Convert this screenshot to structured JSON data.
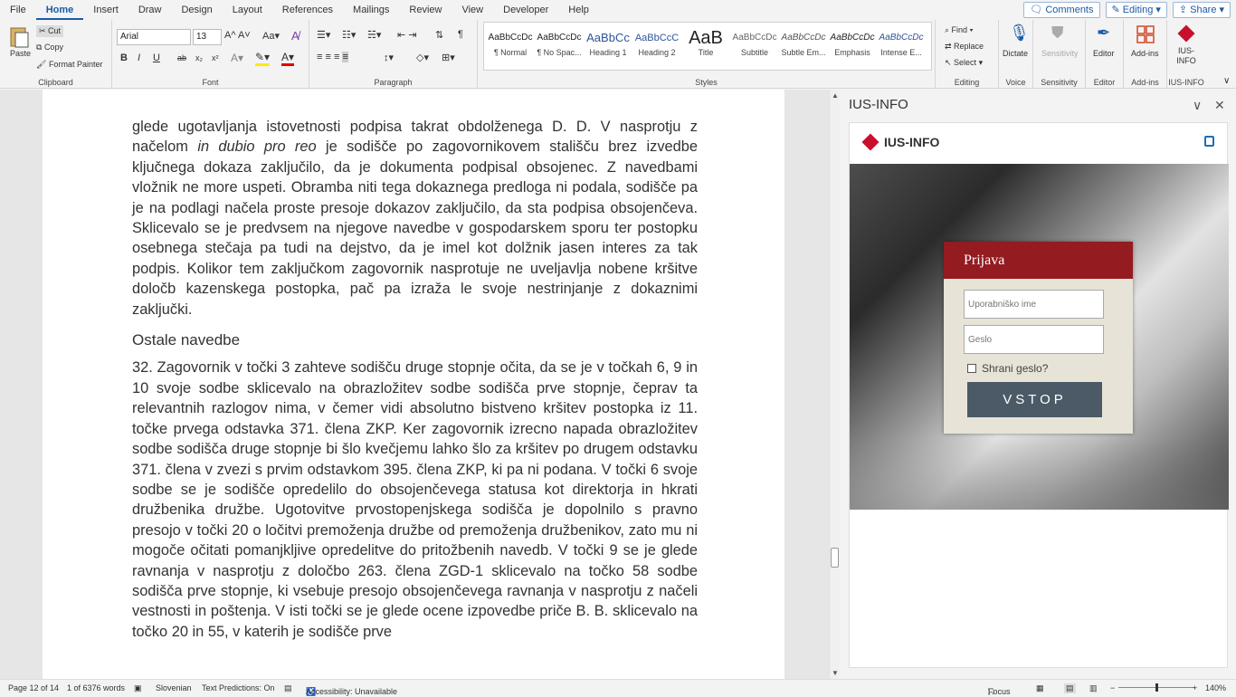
{
  "menu": {
    "tabs": [
      "File",
      "Home",
      "Insert",
      "Draw",
      "Design",
      "Layout",
      "References",
      "Mailings",
      "Review",
      "View",
      "Developer",
      "Help"
    ],
    "active": "Home",
    "comments": "Comments",
    "editing": "Editing",
    "share": "Share"
  },
  "ribbon": {
    "clipboard": {
      "paste": "Paste",
      "cut": "Cut",
      "copy": "Copy",
      "format_painter": "Format Painter",
      "label": "Clipboard"
    },
    "font": {
      "name": "Arial",
      "size": "13",
      "label": "Font",
      "bold": "B",
      "italic": "I",
      "underline": "U",
      "strike": "ab",
      "sub": "x₂",
      "sup": "x²"
    },
    "paragraph": {
      "label": "Paragraph"
    },
    "styles": {
      "label": "Styles",
      "items": [
        {
          "sample": "AaBbCcDc",
          "name": "¶ Normal"
        },
        {
          "sample": "AaBbCcDc",
          "name": "¶ No Spac..."
        },
        {
          "sample": "AaBbCc",
          "name": "Heading 1"
        },
        {
          "sample": "AaBbCcC",
          "name": "Heading 2"
        },
        {
          "sample": "AaB",
          "name": "Title"
        },
        {
          "sample": "AaBbCcDc",
          "name": "Subtitle"
        },
        {
          "sample": "AaBbCcDc",
          "name": "Subtle Em..."
        },
        {
          "sample": "AaBbCcDc",
          "name": "Emphasis"
        },
        {
          "sample": "AaBbCcDc",
          "name": "Intense E..."
        }
      ]
    },
    "editing": {
      "find": "Find",
      "replace": "Replace",
      "select": "Select",
      "label": "Editing"
    },
    "voice": {
      "dictate": "Dictate",
      "label": "Voice"
    },
    "sensitivity": {
      "button": "Sensitivity",
      "label": "Sensitivity"
    },
    "editor": {
      "button": "Editor",
      "label": "Editor"
    },
    "addins": {
      "button": "Add-ins",
      "label": "Add-ins"
    },
    "iusinfo": {
      "button": "IUS-INFO",
      "label": "IUS-INFO"
    }
  },
  "document": {
    "para1_a": "glede ugotavljanja istovetnosti podpisa takrat obdolženega D. D. V nasprotju z načelom ",
    "para1_italic": "in dubio pro reo",
    "para1_b": " je sodišče po zagovornikovem stališču brez izvedbe ključnega dokaza zaključilo, da je dokumenta podpisal obsojenec. Z navedbami vložnik ne more uspeti. Obramba niti tega dokaznega predloga ni podala, sodišče pa je na podlagi načela proste presoje dokazov zaključilo, da sta podpisa obsojenčeva. Sklicevalo se je predvsem na njegove navedbe v gospodarskem sporu ter postopku osebnega stečaja pa tudi na dejstvo, da je imel kot dolžnik jasen interes za tak podpis. Kolikor tem zaključkom zagovornik nasprotuje ne uveljavlja nobene kršitve določb kazenskega postopka, pač pa izraža le svoje nestrinjanje z dokaznimi zaključki.",
    "heading": "Ostale navedbe",
    "para2": "32. Zagovornik v točki 3 zahteve sodišču druge stopnje očita, da se je v točkah 6, 9 in 10 svoje sodbe sklicevalo na obrazložitev sodbe sodišča prve stopnje, čeprav ta relevantnih razlogov nima, v čemer vidi absolutno bistveno kršitev postopka iz 11. točke prvega odstavka 371. člena ZKP. Ker zagovornik izrecno napada obrazložitev sodbe sodišča druge stopnje bi šlo kvečjemu lahko šlo za kršitev po drugem odstavku 371. člena v zvezi s prvim odstavkom 395. člena ZKP, ki pa ni podana. V točki 6 svoje sodbe se je sodišče opredelilo do obsojenčevega statusa kot direktorja in hkrati družbenika družbe. Ugotovitve prvostopenjskega sodišča je dopolnilo s pravno presojo v točki 20 o ločitvi premoženja družbe od premoženja družbenikov, zato mu ni mogoče očitati pomanjkljive opredelitve do pritožbenih navedb. V točki 9 se je glede ravnanja v nasprotju z določbo 263. člena ZGD-1 sklicevalo na točko 58 sodbe sodišča prve stopnje, ki vsebuje presojo obsojenčevega ravnanja v nasprotju z načeli vestnosti in poštenja. V isti točki se je glede ocene izpovedbe priče B. B. sklicevalo na točko 20 in 55, v katerih je sodišče prve"
  },
  "pane": {
    "title": "IUS-INFO",
    "logo": "IUS-INFO",
    "login_title": "Prijava",
    "username_placeholder": "Uporabniško ime",
    "password_placeholder": "Geslo",
    "remember": "Shrani geslo?",
    "submit": "VSTOP"
  },
  "status": {
    "page": "Page 12 of 14",
    "words": "1 of 6376 words",
    "language": "Slovenian",
    "predictions": "Text Predictions: On",
    "accessibility": "Accessibility: Unavailable",
    "focus": "Focus",
    "zoom": "140%",
    "zoom_fraction": 0.5
  },
  "colors": {
    "accent": "#1a5aa8",
    "brand_red": "#941b1f",
    "button": "#4b5a66"
  }
}
